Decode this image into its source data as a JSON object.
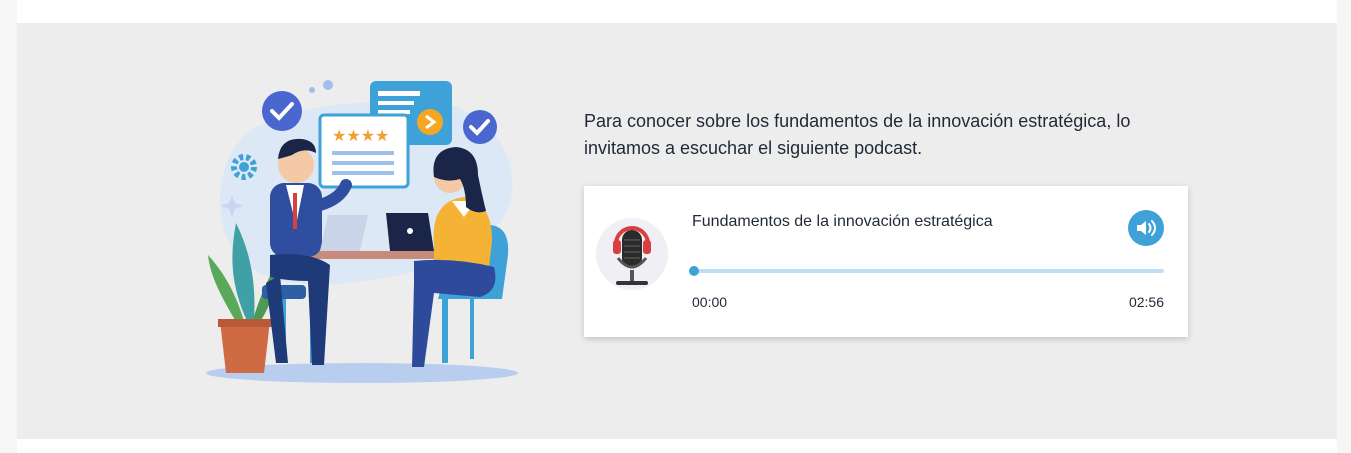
{
  "intro": {
    "text": "Para conocer sobre los fundamentos de la innovación estratégica, lo invitamos a escuchar el siguiente podcast."
  },
  "player": {
    "title": "Fundamentos de la innovación estratégica",
    "current_time": "00:00",
    "total_time": "02:56",
    "progress_fraction": 0,
    "cover_icon": "microphone-icon",
    "volume_icon": "volume-icon",
    "accent_color": "#3ea2d8",
    "track_color": "#bfe0f2"
  },
  "illustration": {
    "icon": "business-meeting-illustration"
  },
  "colors": {
    "section_background": "#ededed",
    "card_background": "#ffffff",
    "text": "#1f2937"
  }
}
